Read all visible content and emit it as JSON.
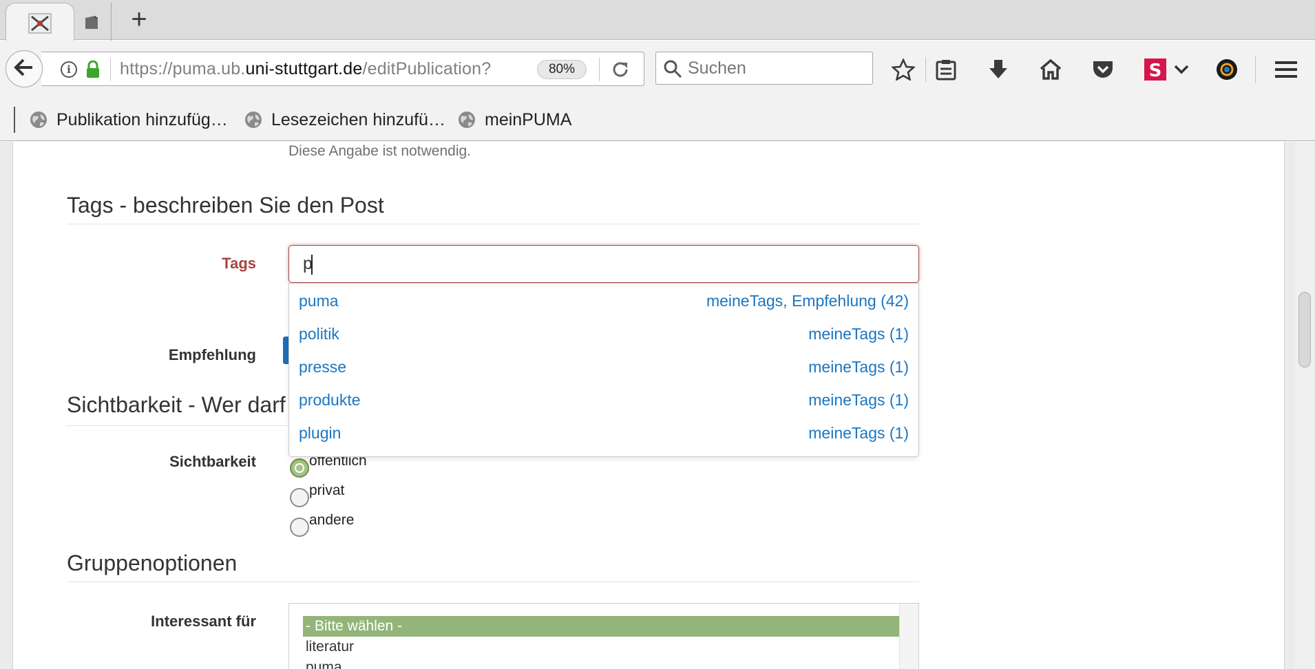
{
  "browser": {
    "url_prefix": "https://puma.ub.",
    "url_domain": "uni-stuttgart.de",
    "url_path": "/editPublication?",
    "zoom": "80%",
    "search_placeholder": "Suchen",
    "bookmarks": [
      {
        "label": "Publikation hinzufüg…"
      },
      {
        "label": "Lesezeichen hinzufü…"
      },
      {
        "label": "meinPUMA"
      }
    ],
    "icons": {
      "tab_active": "puma-logo-icon",
      "tab_inactive": "page-icon",
      "new_tab": "plus-icon",
      "back": "back-arrow-icon",
      "info": "info-icon",
      "lock": "lock-icon",
      "reload": "reload-icon",
      "search": "search-icon",
      "bookmark_star": "star-icon",
      "reading_list": "reading-list-icon",
      "download": "download-icon",
      "home": "home-icon",
      "pocket": "pocket-icon",
      "addon": "s-addon-icon",
      "addon_menu": "chevron-down-icon",
      "extension": "camera-lens-icon",
      "menu": "hamburger-menu-icon"
    },
    "new_tab_label": "+"
  },
  "page": {
    "required_note": "Diese Angabe ist notwendig.",
    "tags_section_title": "Tags - beschreiben Sie den Post",
    "tags_label": "Tags",
    "tags_value": "p",
    "empfehlung_label": "Empfehlung",
    "suggestions": [
      {
        "tag": "puma",
        "source": "meineTags, Empfehlung (42)"
      },
      {
        "tag": "politik",
        "source": "meineTags (1)"
      },
      {
        "tag": "presse",
        "source": "meineTags (1)"
      },
      {
        "tag": "produkte",
        "source": "meineTags (1)"
      },
      {
        "tag": "plugin",
        "source": "meineTags (1)"
      }
    ],
    "visibility_section_title": "Sichtbarkeit - Wer darf",
    "visibility_label": "Sichtbarkeit",
    "visibility_options": [
      {
        "label": "öffentlich",
        "checked": true
      },
      {
        "label": "privat",
        "checked": false
      },
      {
        "label": "andere",
        "checked": false
      }
    ],
    "group_section_title": "Gruppenoptionen",
    "interest_label": "Interessant für",
    "interest_options": [
      {
        "label": "- Bitte wählen -",
        "selected": true
      },
      {
        "label": "literatur",
        "selected": false
      },
      {
        "label": "puma",
        "selected": false
      }
    ]
  },
  "colors": {
    "error_red": "#a94442",
    "link_blue": "#1b76c1",
    "selected_green": "#93b57a"
  }
}
